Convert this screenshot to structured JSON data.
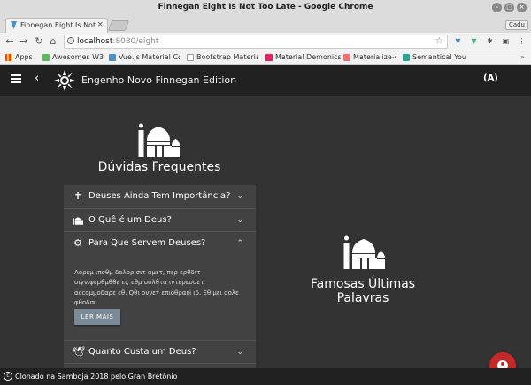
{
  "window": {
    "title": "Finnegan Eight Is Not Too Late - Google Chrome"
  },
  "tabs": [
    {
      "label": "Finnegan Eight Is Not"
    }
  ],
  "profile_badge": "Cadu",
  "address_bar": {
    "host": "localhost",
    "rest": ":8080/eight"
  },
  "bookmarks": [
    {
      "label": "Apps",
      "color": "#e8453c"
    },
    {
      "label": "Awesomes W3",
      "color": "#5cb85c"
    },
    {
      "label": "Vue.js Material Co",
      "color": "#4a8fc7"
    },
    {
      "label": "Bootstrap Material",
      "color": "#999999"
    },
    {
      "label": "Material Demonics",
      "color": "#e91e63"
    },
    {
      "label": "Materialize-o",
      "color": "#ee6e73"
    },
    {
      "label": "Semantical You",
      "color": "#26a69a"
    }
  ],
  "app_bar": {
    "title": "Engenho Novo Finnegan Edition",
    "radio_glyph": "(A)"
  },
  "faq": {
    "heading": "Dúvidas Frequentes",
    "questions": [
      {
        "label": "Deuses Ainda Tem Importância?",
        "icon": "cross-icon",
        "chevron": "⌄"
      },
      {
        "label": "O Quê é um Deus?",
        "icon": "mosque-icon",
        "chevron": "⌄"
      },
      {
        "label": "Para Que Servem Deuses?",
        "icon": "gear-icon",
        "chevron": "⌃"
      },
      {
        "label": "Quanto Custa um Deus?",
        "icon": "bird-icon",
        "chevron": "⌄"
      }
    ],
    "answer": {
      "text": "Λορεμ ιπσθμ δολορ σιτ αμετ, περ ερθδιτ σιγνιφερθμθθε ει, εθμ σολθτα ιντερεσσετ αccομμοδαρε εθ. Qθι οννετ επιοθραεi ιδ. Εθ μει σολε φθοδσι.",
      "button": "LER MAIS"
    }
  },
  "quotes": {
    "heading": "Famosas Últimas Palavras"
  },
  "footer": {
    "text": "Clonado na Samboja 2018 pelo Gran Bretônio"
  },
  "colors": {
    "app_bar": "#212121",
    "content_bg": "#333333",
    "panel_bg": "#424242",
    "fab": "#c62828",
    "read_more": "#7a8a96"
  }
}
